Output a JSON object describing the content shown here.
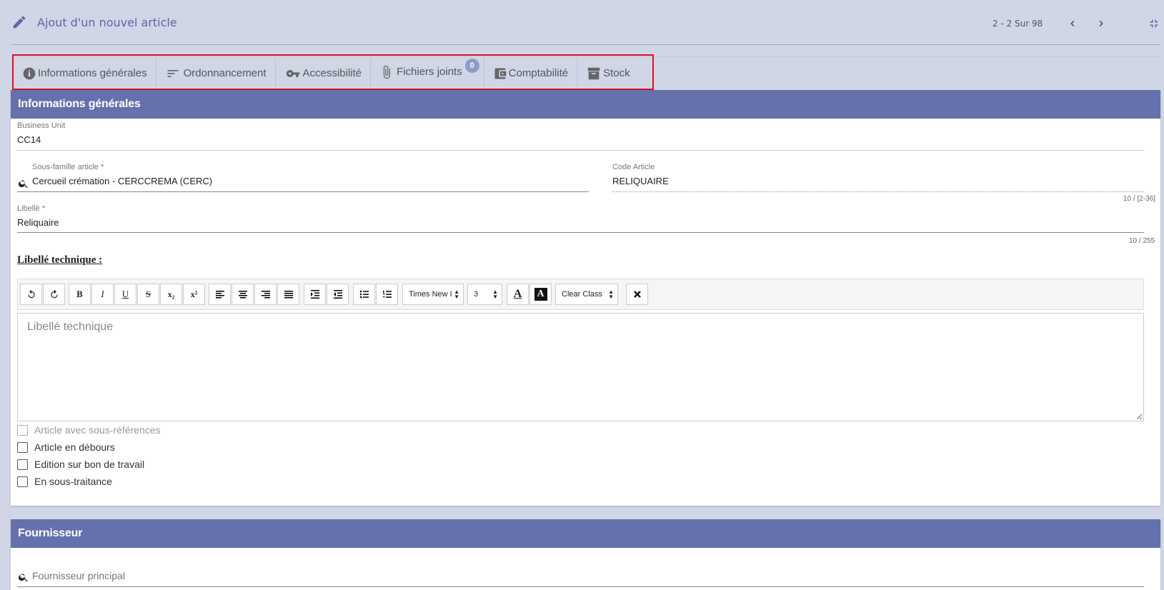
{
  "header": {
    "title": "Ajout d'un nouvel article",
    "pager": "2 - 2 Sur 98"
  },
  "tabs": [
    {
      "label": "Informations générales",
      "icon": "info-icon"
    },
    {
      "label": "Ordonnancement",
      "icon": "sort-icon"
    },
    {
      "label": "Accessibilité",
      "icon": "key-icon"
    },
    {
      "label": "Fichiers joints",
      "icon": "paperclip-icon",
      "badge": "0"
    },
    {
      "label": "Comptabilité",
      "icon": "wallet-icon"
    },
    {
      "label": "Stock",
      "icon": "archive-icon"
    }
  ],
  "general": {
    "section_title": "Informations générales",
    "business_unit": {
      "label": "Business Unit",
      "value": "CC14"
    },
    "sous_famille": {
      "label": "Sous-famille article *",
      "value": "Cercueil crémation - CERCCREMA (CERC)"
    },
    "code_article": {
      "label": "Code Article",
      "value": "RELIQUAIRE",
      "counter": "10 / [2-36]"
    },
    "libelle": {
      "label": "Libellé *",
      "value": "Reliquaire",
      "counter": "10 / 255"
    },
    "libelle_technique": {
      "label": "Libellé technique :",
      "placeholder": "Libellé technique",
      "font_family": "Times New I",
      "font_size": "3",
      "class_select": "Clear Class"
    },
    "checkboxes": [
      {
        "label": "Article avec sous-références",
        "disabled": true
      },
      {
        "label": "Article en débours",
        "disabled": false
      },
      {
        "label": "Edition sur bon de travail",
        "disabled": false
      },
      {
        "label": "En sous-traitance",
        "disabled": false
      }
    ]
  },
  "fournisseur": {
    "section_title": "Fournisseur",
    "placeholder": "Fournisseur principal"
  },
  "colors": {
    "accent": "#6471ad",
    "background": "#d1d6e6",
    "highlight": "#e0101f",
    "badge": "#8e9acb"
  }
}
